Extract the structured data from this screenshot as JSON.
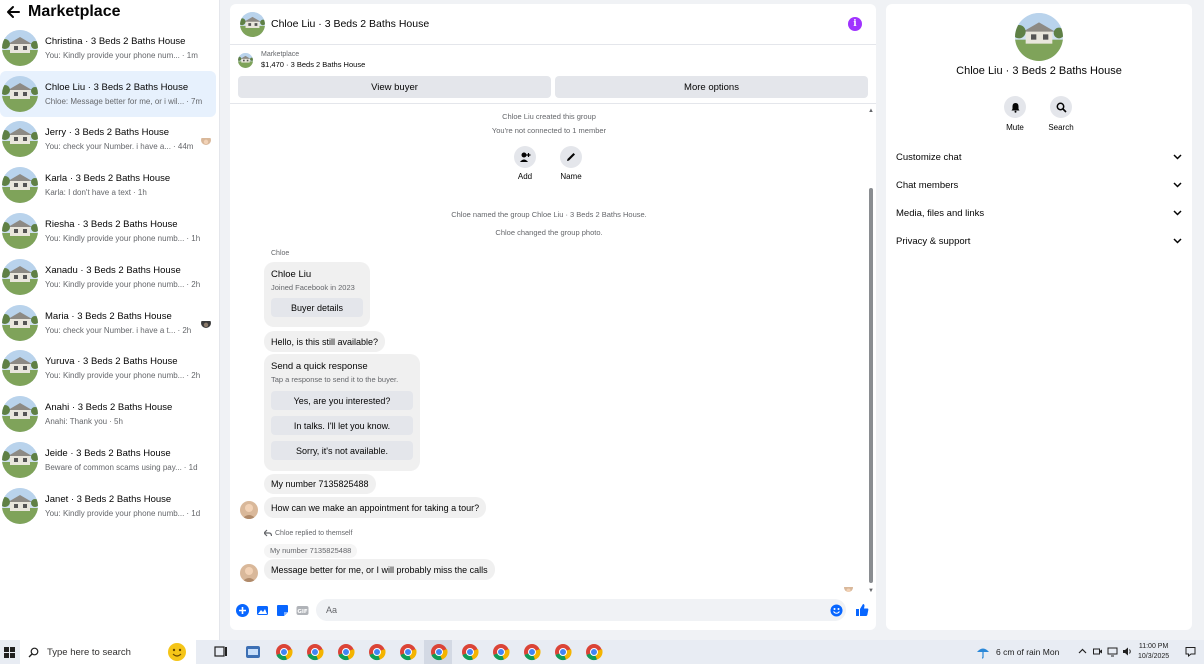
{
  "sidebar": {
    "title": "Marketplace",
    "conversations": [
      {
        "name": "Christina · 3 Beds 2 Baths House",
        "preview": "You: Kindly provide your phone num...",
        "time": "· 1m"
      },
      {
        "name": "Chloe Liu · 3 Beds 2 Baths House",
        "preview": "Chloe: Message better for me, or i wil...",
        "time": "· 7m"
      },
      {
        "name": "Jerry · 3 Beds 2 Baths House",
        "preview": "You: check your Number. i have a...",
        "time": "· 44m"
      },
      {
        "name": "Karla · 3 Beds 2 Baths House",
        "preview": "Karla: I don't have a text",
        "time": "· 1h"
      },
      {
        "name": "Riesha · 3 Beds 2 Baths House",
        "preview": "You: Kindly provide your phone numb...",
        "time": "· 1h"
      },
      {
        "name": "Xanadu · 3 Beds 2 Baths House",
        "preview": "You: Kindly provide your phone numb...",
        "time": "· 2h"
      },
      {
        "name": "Maria · 3 Beds 2 Baths House",
        "preview": "You: check your Number. i have a t...",
        "time": "· 2h"
      },
      {
        "name": "Yuruva · 3 Beds 2 Baths House",
        "preview": "You: Kindly provide your phone numb...",
        "time": "· 2h"
      },
      {
        "name": "Anahi · 3 Beds 2 Baths House",
        "preview": "Anahi: Thank you",
        "time": "· 5h"
      },
      {
        "name": "Jeide · 3 Beds 2 Baths House",
        "preview": "Beware of common scams using pay...",
        "time": "· 1d"
      },
      {
        "name": "Janet · 3 Beds 2 Baths House",
        "preview": "You: Kindly provide your phone numb...",
        "time": "· 1d"
      }
    ]
  },
  "chat": {
    "title": "Chloe Liu · 3 Beds 2 Baths House",
    "listing_source": "Marketplace",
    "listing_price": "$1,470 · 3 Beds 2 Baths House",
    "view_buyer": "View buyer",
    "more_options": "More options",
    "created_group": "Chloe Liu created this group",
    "not_connected": "You're not connected to 1 member",
    "add_label": "Add",
    "name_label": "Name",
    "named_group": "Chloe named the group Chloe Liu · 3 Beds 2 Baths House.",
    "changed_photo": "Chloe changed the group photo.",
    "sender": "Chloe",
    "buyer_name": "Chloe Liu",
    "buyer_joined": "Joined Facebook in 2023",
    "buyer_details": "Buyer details",
    "msg_available": "Hello, is this still available?",
    "quick_title": "Send a quick response",
    "quick_sub": "Tap a response to send it to the buyer.",
    "quick_1": "Yes, are you interested?",
    "quick_2": "In talks. I'll let you know.",
    "quick_3": "Sorry, it's not available.",
    "msg_number": "My number 7135825488",
    "msg_appointment": "How can we make an appointment for taking a tour?",
    "reply_note": "Chloe replied to themself",
    "reply_quote": "My number 7135825488",
    "msg_last": "Message better for me, or I will probably miss the calls",
    "composer_placeholder": "Aa"
  },
  "panel": {
    "title": "Chloe Liu · 3 Beds 2 Baths House",
    "mute": "Mute",
    "search": "Search",
    "sections": [
      "Customize chat",
      "Chat members",
      "Media, files and links",
      "Privacy & support"
    ]
  },
  "taskbar": {
    "search_placeholder": "Type here to search",
    "weather": "6 cm of rain Mon",
    "time": "11:00 PM",
    "date": "10/3/2025"
  },
  "colors": {
    "accent": "#0866ff",
    "info_purple": "#a033ff",
    "active_row": "#e7f1fd",
    "bubble": "#f0f0f0"
  }
}
